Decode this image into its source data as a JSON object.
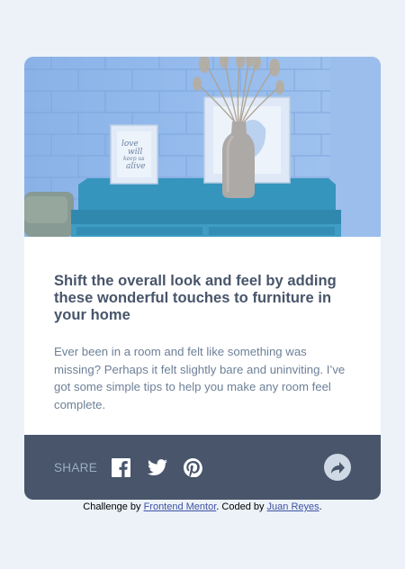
{
  "colors": {
    "page_bg": "#ECF2F8",
    "title": "#48556A",
    "body_text": "#6E8098",
    "share_bar": "#48556A",
    "share_text": "#9DAEC2",
    "share_button_bg": "#CFD9E5",
    "link": "#3E52A3"
  },
  "article": {
    "image_alt": "drawers",
    "frame_text": "love will keep us alive",
    "title": "Shift the overall look and feel by adding these wonderful touches to furniture in your home",
    "description": "Ever been in a room and felt like something was missing? Perhaps it felt slightly bare and uninviting. I’ve got some simple tips to help you make any room feel complete."
  },
  "share": {
    "label": "SHARE",
    "icons": [
      "facebook-icon",
      "twitter-icon",
      "pinterest-icon"
    ],
    "button_icon": "share-arrow-icon"
  },
  "attribution": {
    "prefix": "Challenge by",
    "link1": "Frontend Mentor",
    "middle": ". Coded by",
    "link2": "Juan Reyes",
    "suffix": "."
  }
}
